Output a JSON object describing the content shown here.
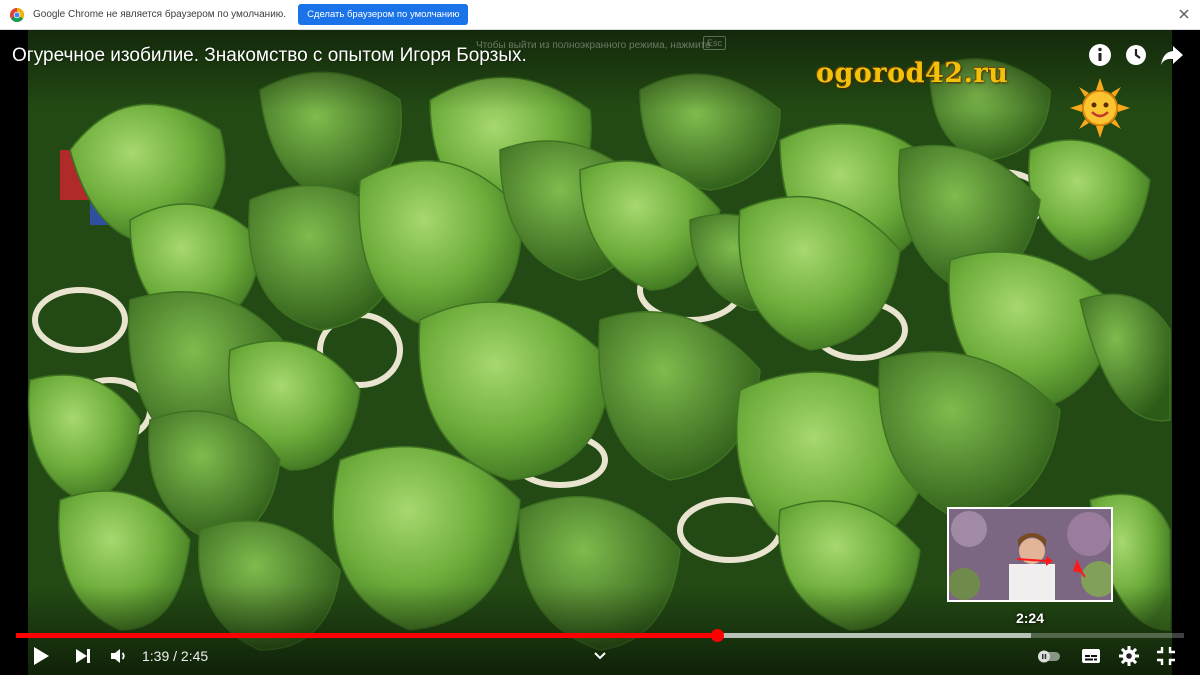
{
  "infobar": {
    "message": "Google Chrome не является браузером по умолчанию.",
    "button_label": "Сделать браузером по умолчанию"
  },
  "video": {
    "title": "Огуречное изобилие. Знакомство с опытом Игоря Борзых.",
    "fullscreen_hint": "Чтобы выйти из полноэкранного режима, нажмите",
    "fullscreen_hint_key": "Esc",
    "watermark": "ogorod42.ru",
    "preview_time": "2:24"
  },
  "player": {
    "current_time": "1:39",
    "separator": " / ",
    "duration": "2:45",
    "played_fraction": 0.6,
    "buffered_fraction": 0.869,
    "autoplay": "off"
  },
  "colors": {
    "accent": "#ff0000",
    "infobar_button": "#1a73e8",
    "watermark": "#f2c10a"
  },
  "icons": [
    "chrome-logo-icon",
    "close-icon",
    "info-icon",
    "watch-later-icon",
    "share-icon",
    "play-icon",
    "next-icon",
    "volume-icon",
    "chevron-down-icon",
    "autoplay-toggle-icon",
    "subtitles-icon",
    "settings-icon",
    "exit-fullscreen-icon"
  ]
}
